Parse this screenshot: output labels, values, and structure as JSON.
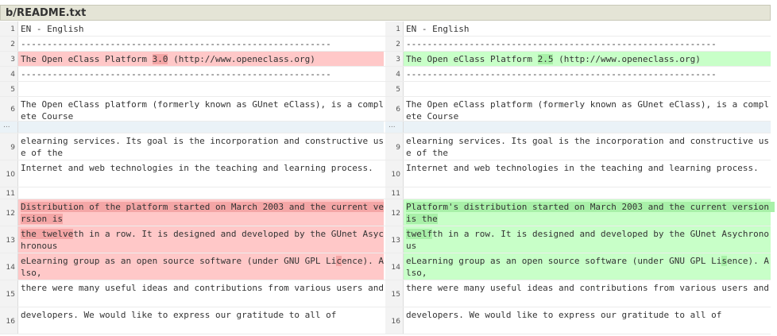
{
  "file": {
    "path": "b/README.txt"
  },
  "rows": [
    {
      "type": "ctx",
      "ln": "1",
      "rn": "1",
      "left": "EN - English",
      "right": "EN - English"
    },
    {
      "type": "ctx",
      "ln": "2",
      "rn": "2",
      "left": "-----------------------------------------------------------",
      "right": "-----------------------------------------------------------"
    },
    {
      "type": "chg",
      "ln": "3",
      "rn": "3",
      "left_pre": "The Open eClass Platform ",
      "left_hl": "3.0",
      "left_post": " (http://www.openeclass.org)",
      "right_pre": "The Open eClass Platform ",
      "right_hl": "2.5",
      "right_post": " (http://www.openeclass.org)"
    },
    {
      "type": "ctx",
      "ln": "4",
      "rn": "4",
      "left": "-----------------------------------------------------------",
      "right": "-----------------------------------------------------------"
    },
    {
      "type": "ctx",
      "ln": "5",
      "rn": "5",
      "left": "",
      "right": ""
    },
    {
      "type": "ctx",
      "ln": "6",
      "rn": "6",
      "left": "The Open eClass platform (formerly known as GUnet eClass), is a complete Course",
      "right": "The Open eClass platform (formerly known as GUnet eClass), is a complete Course"
    },
    {
      "type": "skip",
      "ln": "...",
      "rn": "..."
    },
    {
      "type": "ctx",
      "ln": "9",
      "rn": "9",
      "left": "elearning services. Its goal is the incorporation and constructive use of the",
      "right": "elearning services. Its goal is the incorporation and constructive use of the"
    },
    {
      "type": "ctx",
      "ln": "10",
      "rn": "10",
      "left": "Internet and web technologies in the teaching and learning process.",
      "right": "Internet and web technologies in the teaching and learning process."
    },
    {
      "type": "ctx",
      "ln": "11",
      "rn": "11",
      "left": "",
      "right": ""
    },
    {
      "type": "chg",
      "ln": "12",
      "rn": "12",
      "left_pre": "",
      "left_hl": "Distribution of the platform started on March 2003 and the current version is",
      "left_post": "",
      "right_pre": "",
      "right_hl": "Platform's distribution started on March 2003 and the current version is the",
      "right_post": ""
    },
    {
      "type": "chg",
      "ln": "13",
      "rn": "13",
      "left_pre": "",
      "left_hl": "the twelve",
      "left_post": "th in a row. It is designed and developed by the GUnet Asychronous",
      "right_pre": "",
      "right_hl": "twelf",
      "right_post": "th in a row. It is designed and developed by the GUnet Asychronous"
    },
    {
      "type": "chg",
      "ln": "14",
      "rn": "14",
      "left_pre": "eLearning group as an open source software (under GNU GPL Li",
      "left_hl": "c",
      "left_post": "ence). Also,",
      "right_pre": "eLearning group as an open source software (under GNU GPL Li",
      "right_hl": "s",
      "right_post": "ence). Also,"
    },
    {
      "type": "ctx",
      "ln": "15",
      "rn": "15",
      "left": "there were many useful ideas and contributions from various users and",
      "right": "there were many useful ideas and contributions from various users and"
    },
    {
      "type": "ctx",
      "ln": "16",
      "rn": "16",
      "left": "developers. We would like to express our gratitude to all of",
      "right": "developers. We would like to express our gratitude to all of"
    }
  ]
}
